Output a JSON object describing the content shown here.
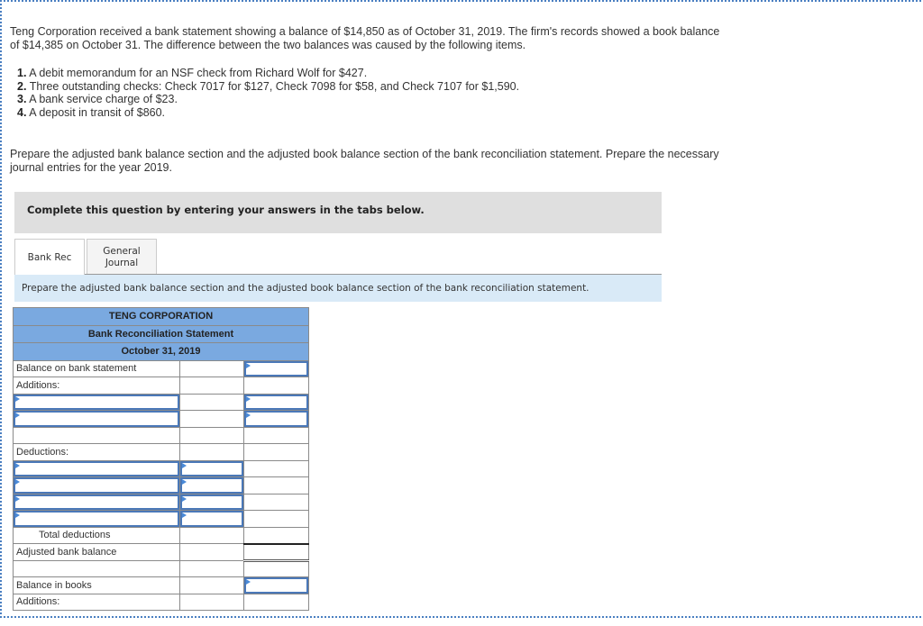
{
  "problem": {
    "intro": "Teng Corporation received a bank statement showing a balance of $14,850 as of October 31, 2019. The firm's records showed a book balance of $14,385 on October 31. The difference between the two balances was caused by the following items.",
    "items": [
      {
        "num": "1.",
        "text": "A debit memorandum for an NSF check from Richard Wolf for $427."
      },
      {
        "num": "2.",
        "text": "Three outstanding checks: Check 7017 for $127, Check 7098 for $58, and Check 7107 for $1,590."
      },
      {
        "num": "3.",
        "text": "A bank service charge of $23."
      },
      {
        "num": "4.",
        "text": "A deposit in transit of $860."
      }
    ],
    "instructions": "Prepare the adjusted bank balance section and the adjusted book balance section of the bank reconciliation statement. Prepare the necessary journal entries for the year 2019."
  },
  "complete_banner": "Complete this question by entering your answers in the tabs below.",
  "tabs": [
    {
      "label": "Bank Rec",
      "active": true
    },
    {
      "label": "General Journal",
      "active": false
    }
  ],
  "tab_prompt": "Prepare the adjusted bank balance section and the adjusted book balance section of the bank reconciliation statement.",
  "statement": {
    "company": "TENG CORPORATION",
    "title": "Bank Reconciliation Statement",
    "date": "October 31, 2019",
    "labels": {
      "balance_bank": "Balance on bank statement",
      "additions": "Additions:",
      "deductions": "Deductions:",
      "total_deductions": "Total deductions",
      "adjusted_bank": "Adjusted bank balance",
      "balance_books": "Balance in books",
      "additions_books": "Additions:"
    }
  }
}
